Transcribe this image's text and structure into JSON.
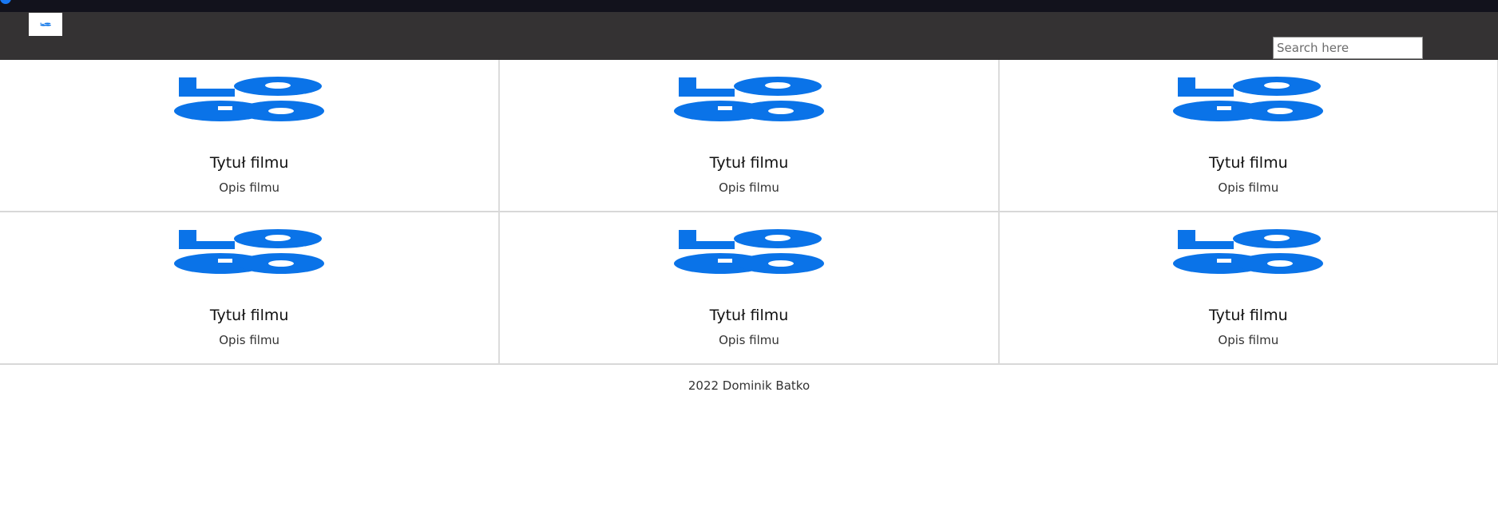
{
  "colors": {
    "topbar": "#12121c",
    "navbar": "#343233",
    "logo_blue": "#0a73e8",
    "card_border": "#dcdcdc"
  },
  "brand": {
    "logo_text": "LOGO"
  },
  "search": {
    "placeholder": "Search here",
    "value": ""
  },
  "cards": [
    {
      "image": "LOGO",
      "title": "Tytuł filmu",
      "description": "Opis filmu"
    },
    {
      "image": "LOGO",
      "title": "Tytuł filmu",
      "description": "Opis filmu"
    },
    {
      "image": "LOGO",
      "title": "Tytuł filmu",
      "description": "Opis filmu"
    },
    {
      "image": "LOGO",
      "title": "Tytuł filmu",
      "description": "Opis filmu"
    },
    {
      "image": "LOGO",
      "title": "Tytuł filmu",
      "description": "Opis filmu"
    },
    {
      "image": "LOGO",
      "title": "Tytuł filmu",
      "description": "Opis filmu"
    }
  ],
  "footer": {
    "text": "2022 Dominik Batko"
  }
}
